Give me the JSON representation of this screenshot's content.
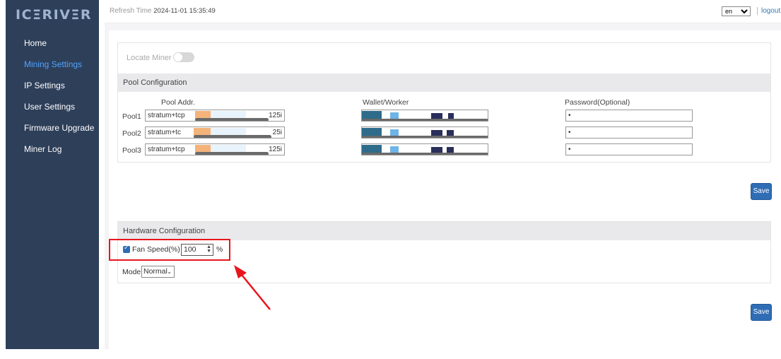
{
  "brand": {
    "logo": "ICΞRIVΞR"
  },
  "sidebar": {
    "items": [
      {
        "label": "Home",
        "active": false
      },
      {
        "label": "Mining Settings",
        "active": true
      },
      {
        "label": "IP Settings",
        "active": false
      },
      {
        "label": "User Settings",
        "active": false
      },
      {
        "label": "Firmware Upgrade",
        "active": false
      },
      {
        "label": "Miner Log",
        "active": false
      }
    ]
  },
  "header": {
    "refresh_label": "Refresh Time",
    "refresh_time": "2024-11-01 15:35:49",
    "language": "en",
    "logout": "logout"
  },
  "locate": {
    "label": "Locate Miner",
    "enabled": false
  },
  "pool": {
    "section_title": "Pool Configuration",
    "col_addr": "Pool Addr.",
    "col_wallet": "Wallet/Worker",
    "col_password": "Password(Optional)",
    "rows": [
      {
        "label": "Pool1",
        "addr_start": "stratum+tcp",
        "addr_end": "125i",
        "password": "•"
      },
      {
        "label": "Pool2",
        "addr_start": "stratum+tc",
        "addr_end": "25i",
        "password": "•"
      },
      {
        "label": "Pool3",
        "addr_start": "stratum+tcp",
        "addr_end": "125i",
        "password": "•"
      }
    ],
    "save_label": "Save"
  },
  "hardware": {
    "section_title": "Hardware Configuration",
    "fan_label": "Fan Speed(%)",
    "fan_enabled": true,
    "fan_value": "100",
    "fan_unit": "%",
    "mode_label": "Mode",
    "mode_value": "Normal",
    "save_label": "Save"
  },
  "colors": {
    "sidebar_bg": "#2e3f5a",
    "accent": "#2f6db5",
    "annotation": "#e8161c"
  }
}
